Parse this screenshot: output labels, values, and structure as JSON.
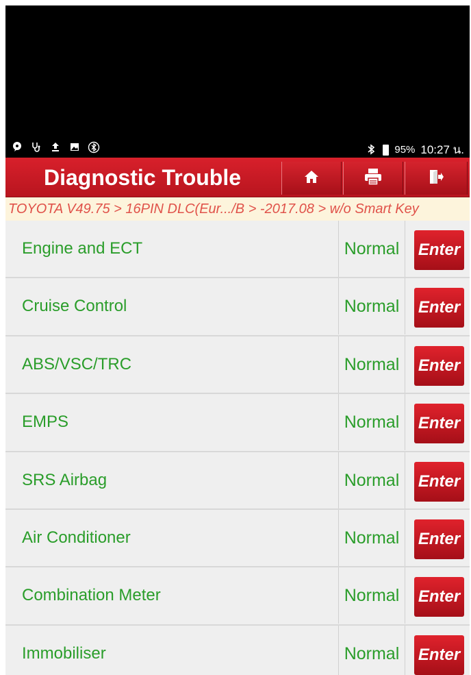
{
  "status_bar": {
    "left_icons": [
      "chat-icon",
      "stethoscope-icon",
      "upload-icon",
      "image-icon",
      "bluetooth-alt-icon"
    ],
    "battery_percent": "95%",
    "time": "10:27 น."
  },
  "header": {
    "title": "Diagnostic Trouble",
    "buttons": [
      "home-icon",
      "printer-icon",
      "exit-icon"
    ]
  },
  "breadcrumb": "TOYOTA V49.75 > 16PIN DLC(Eur.../B > -2017.08 > w/o Smart Key",
  "rows": [
    {
      "name": "Engine and ECT",
      "status": "Normal",
      "action": "Enter"
    },
    {
      "name": "Cruise Control",
      "status": "Normal",
      "action": "Enter"
    },
    {
      "name": "ABS/VSC/TRC",
      "status": "Normal",
      "action": "Enter"
    },
    {
      "name": "EMPS",
      "status": "Normal",
      "action": "Enter"
    },
    {
      "name": "SRS Airbag",
      "status": "Normal",
      "action": "Enter"
    },
    {
      "name": "Air Conditioner",
      "status": "Normal",
      "action": "Enter"
    },
    {
      "name": "Combination Meter",
      "status": "Normal",
      "action": "Enter"
    },
    {
      "name": "Immobiliser",
      "status": "Normal",
      "action": "Enter"
    }
  ],
  "colors": {
    "header_red": "#c81a24",
    "text_green": "#2a9d2a",
    "breadcrumb_text": "#e0524a",
    "breadcrumb_bg": "#fdf4dc"
  }
}
